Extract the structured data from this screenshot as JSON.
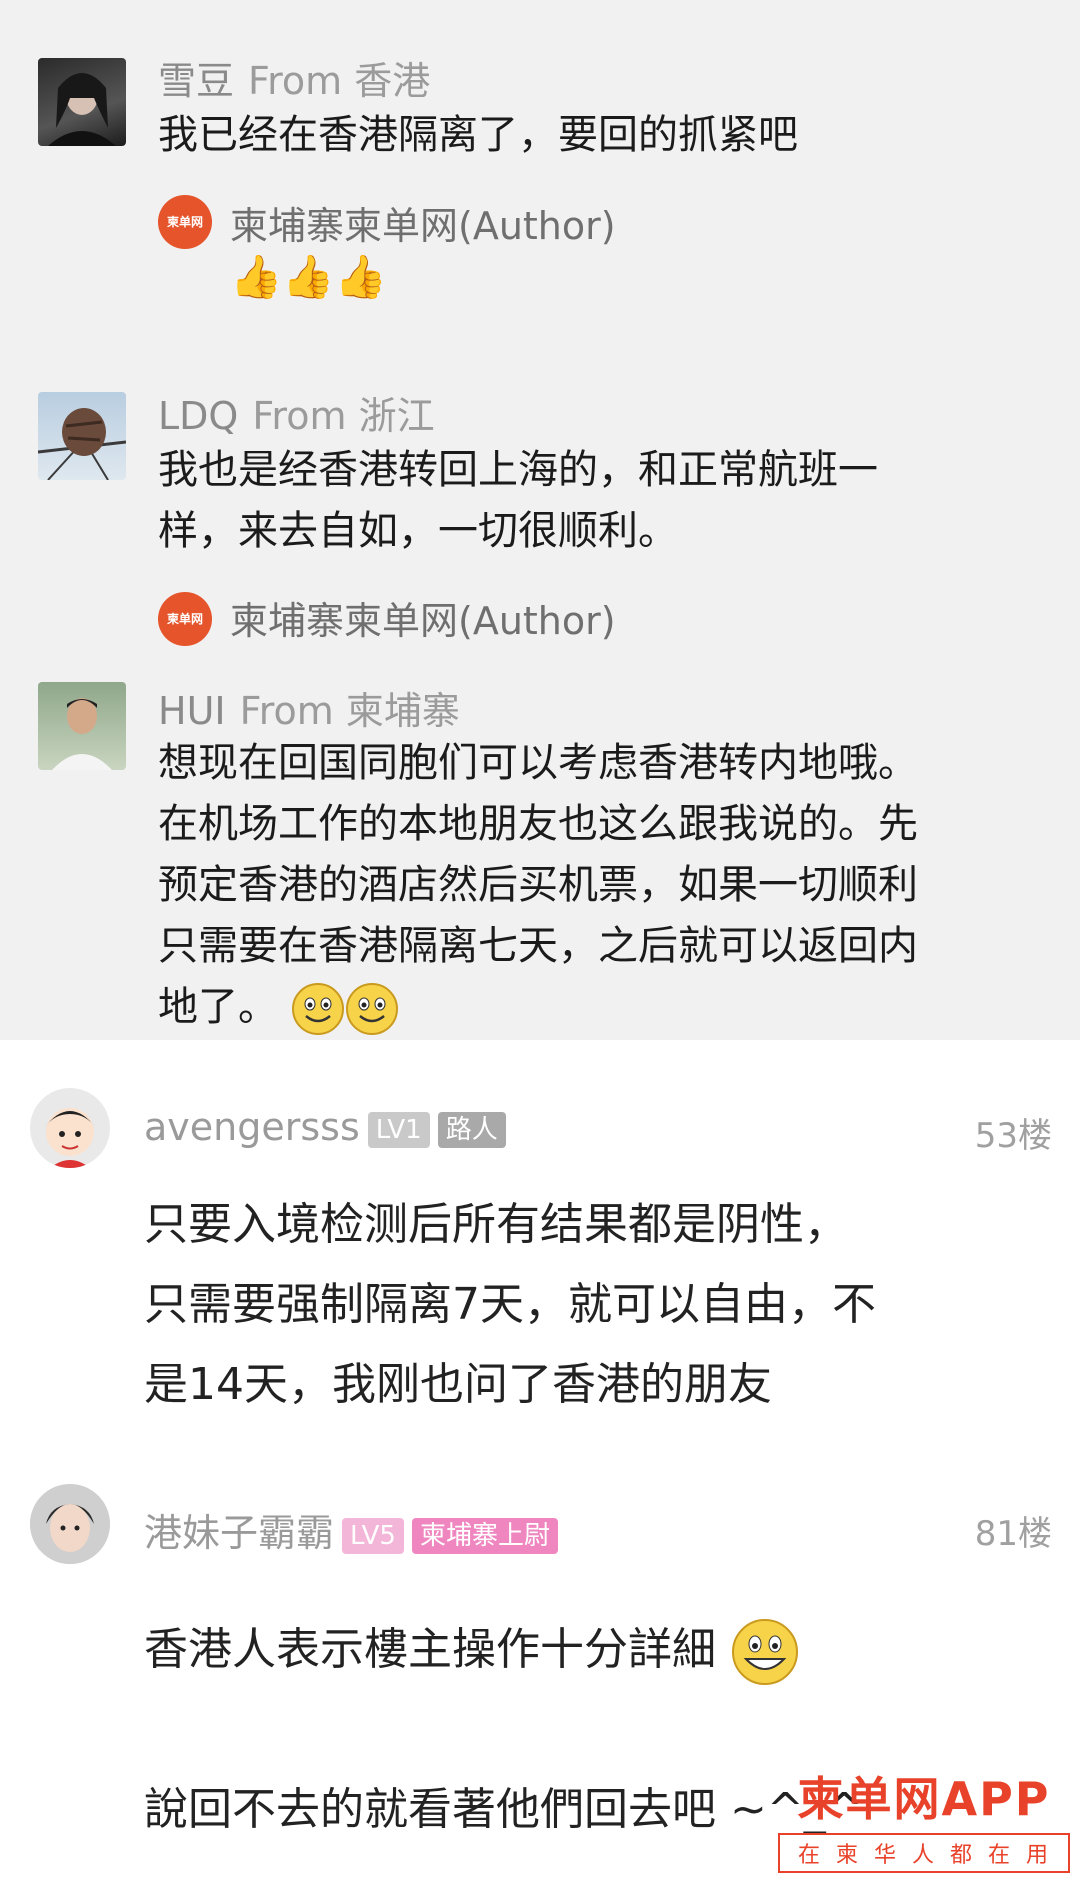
{
  "comments_wechat": [
    {
      "name": "雪豆",
      "from": "From 香港",
      "text": "我已经在香港隔离了，要回的抓紧吧",
      "author_name": "柬埔寨柬单网(Author)",
      "author_reply": "👍👍👍"
    },
    {
      "name": "LDQ",
      "from": "From 浙江",
      "text_line1": "我也是经香港转回上海的，和正常航班一",
      "text_line2": "样，来去自如，一切很顺利。",
      "author_name": "柬埔寨柬单网(Author)"
    },
    {
      "name": "HUI",
      "from": "From 柬埔寨",
      "text_line1": "想现在回国同胞们可以考虑香港转内地哦。",
      "text_line2": "在机场工作的本地朋友也这么跟我说的。先",
      "text_line3": "预定香港的酒店然后买机票，如果一切顺利",
      "text_line4": "只需要在香港隔离七天，之后就可以返回内",
      "text_line5": "地了。"
    }
  ],
  "author_logo_text": "柬单网",
  "comments_forum": [
    {
      "name": "avengersss",
      "level": "LV1",
      "role": "路人",
      "floor": "53楼",
      "text_line1": "只要入境检测后所有结果都是阴性，",
      "text_line2": "只需要强制隔离7天，就可以自由，不",
      "text_line3": "是14天，我刚也问了香港的朋友"
    },
    {
      "name": "港妹子霸霸",
      "level": "LV5",
      "role": "柬埔寨上尉",
      "floor": "81楼",
      "text_line1": "香港人表示樓主操作十分詳細",
      "text_line2": "說回不去的就看著他們回去吧 ~^_^"
    }
  ],
  "watermark": {
    "main": "柬单网APP",
    "sub": "在柬华人都在用"
  },
  "colors": {
    "wechat_bg": "#f1f1f1",
    "forum_bg": "#ffffff",
    "brand_red": "#e8432a",
    "lv5_pink": "#f4b6d8",
    "role5_pink": "#ef86c0"
  }
}
